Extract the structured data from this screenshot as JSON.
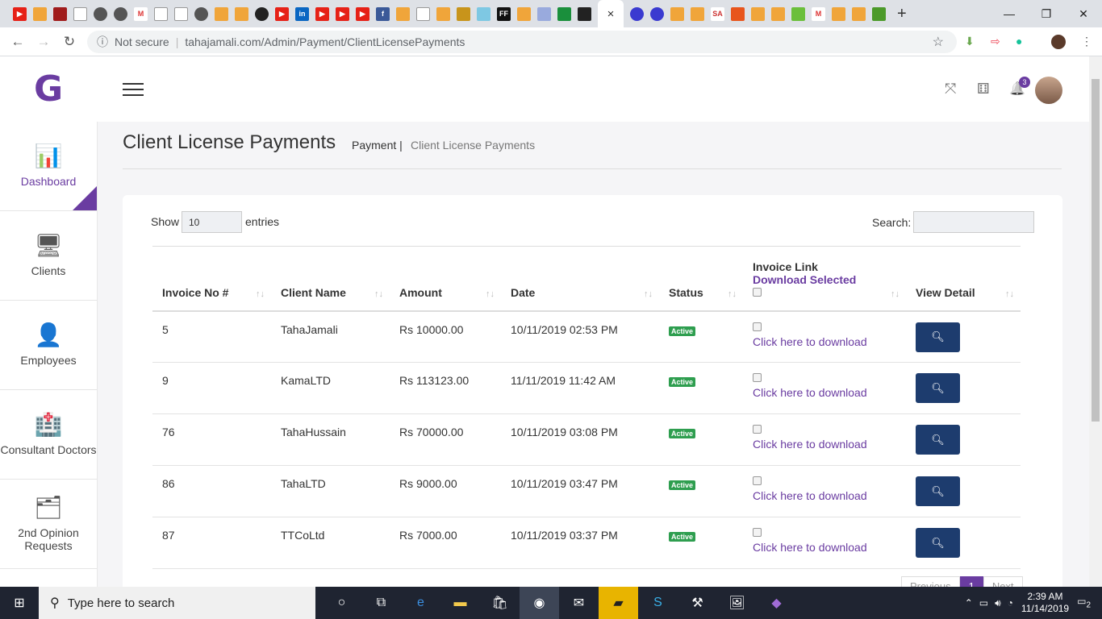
{
  "browser": {
    "tab_close": "×",
    "new_tab": "+",
    "window_controls": [
      "—",
      "❐",
      "✕"
    ],
    "security_label": "Not secure",
    "url": "tahajamali.com/Admin/Payment/ClientLicensePayments",
    "back": "←",
    "forward": "→",
    "reload": "↻",
    "info": "ⓘ",
    "star": "☆"
  },
  "header": {
    "logo": "G",
    "notification_count": "3",
    "fullscreen_icon": "⤧",
    "grid_icon": "⚅",
    "bell_icon": "🔔"
  },
  "sidebar": {
    "items": [
      {
        "label": "Dashboard",
        "icon": "chart-icon",
        "glyph": "📊"
      },
      {
        "label": "Clients",
        "icon": "monitor-user-icon",
        "glyph": "🖥"
      },
      {
        "label": "Employees",
        "icon": "user-icon",
        "glyph": "👤"
      },
      {
        "label": "Consultant Doctors",
        "icon": "hospital-icon",
        "glyph": "🏥"
      },
      {
        "label": "2nd Opinion Requests",
        "icon": "folder-search-icon",
        "glyph": "🗂"
      }
    ]
  },
  "page": {
    "title": "Client License Payments",
    "breadcrumb_parent": "Payment",
    "breadcrumb_current": "Client License Payments"
  },
  "table_controls": {
    "show_label": "Show",
    "page_size": "10",
    "entries_label": "entries",
    "search_label": "Search:",
    "search_value": ""
  },
  "columns": {
    "invoice": "Invoice No #",
    "client": "Client Name",
    "amount": "Amount",
    "date": "Date",
    "status": "Status",
    "invoice_link": "Invoice Link",
    "download_selected": "Download Selected",
    "view": "View Detail"
  },
  "rows": [
    {
      "invoice": "5",
      "client": "TahaJamali",
      "amount": "Rs 10000.00",
      "date": "10/11/2019 02:53 PM",
      "status": "Active",
      "link": "Click here to download"
    },
    {
      "invoice": "9",
      "client": "KamaLTD",
      "amount": "Rs 113123.00",
      "date": "11/11/2019 11:42 AM",
      "status": "Active",
      "link": "Click here to download"
    },
    {
      "invoice": "76",
      "client": "TahaHussain",
      "amount": "Rs 70000.00",
      "date": "10/11/2019 03:08 PM",
      "status": "Active",
      "link": "Click here to download"
    },
    {
      "invoice": "86",
      "client": "TahaLTD",
      "amount": "Rs 9000.00",
      "date": "10/11/2019 03:47 PM",
      "status": "Active",
      "link": "Click here to download"
    },
    {
      "invoice": "87",
      "client": "TTCoLtd",
      "amount": "Rs 7000.00",
      "date": "10/11/2019 03:37 PM",
      "status": "Active",
      "link": "Click here to download"
    }
  ],
  "pagination": {
    "previous": "Previous",
    "current": "1",
    "next": "Next"
  },
  "taskbar": {
    "search_placeholder": "Type here to search",
    "time": "2:39 AM",
    "date": "11/14/2019",
    "notification_count": "2"
  },
  "colors": {
    "accent": "#6a3ca1",
    "button": "#1d3c6e",
    "status": "#2e9e4f"
  }
}
